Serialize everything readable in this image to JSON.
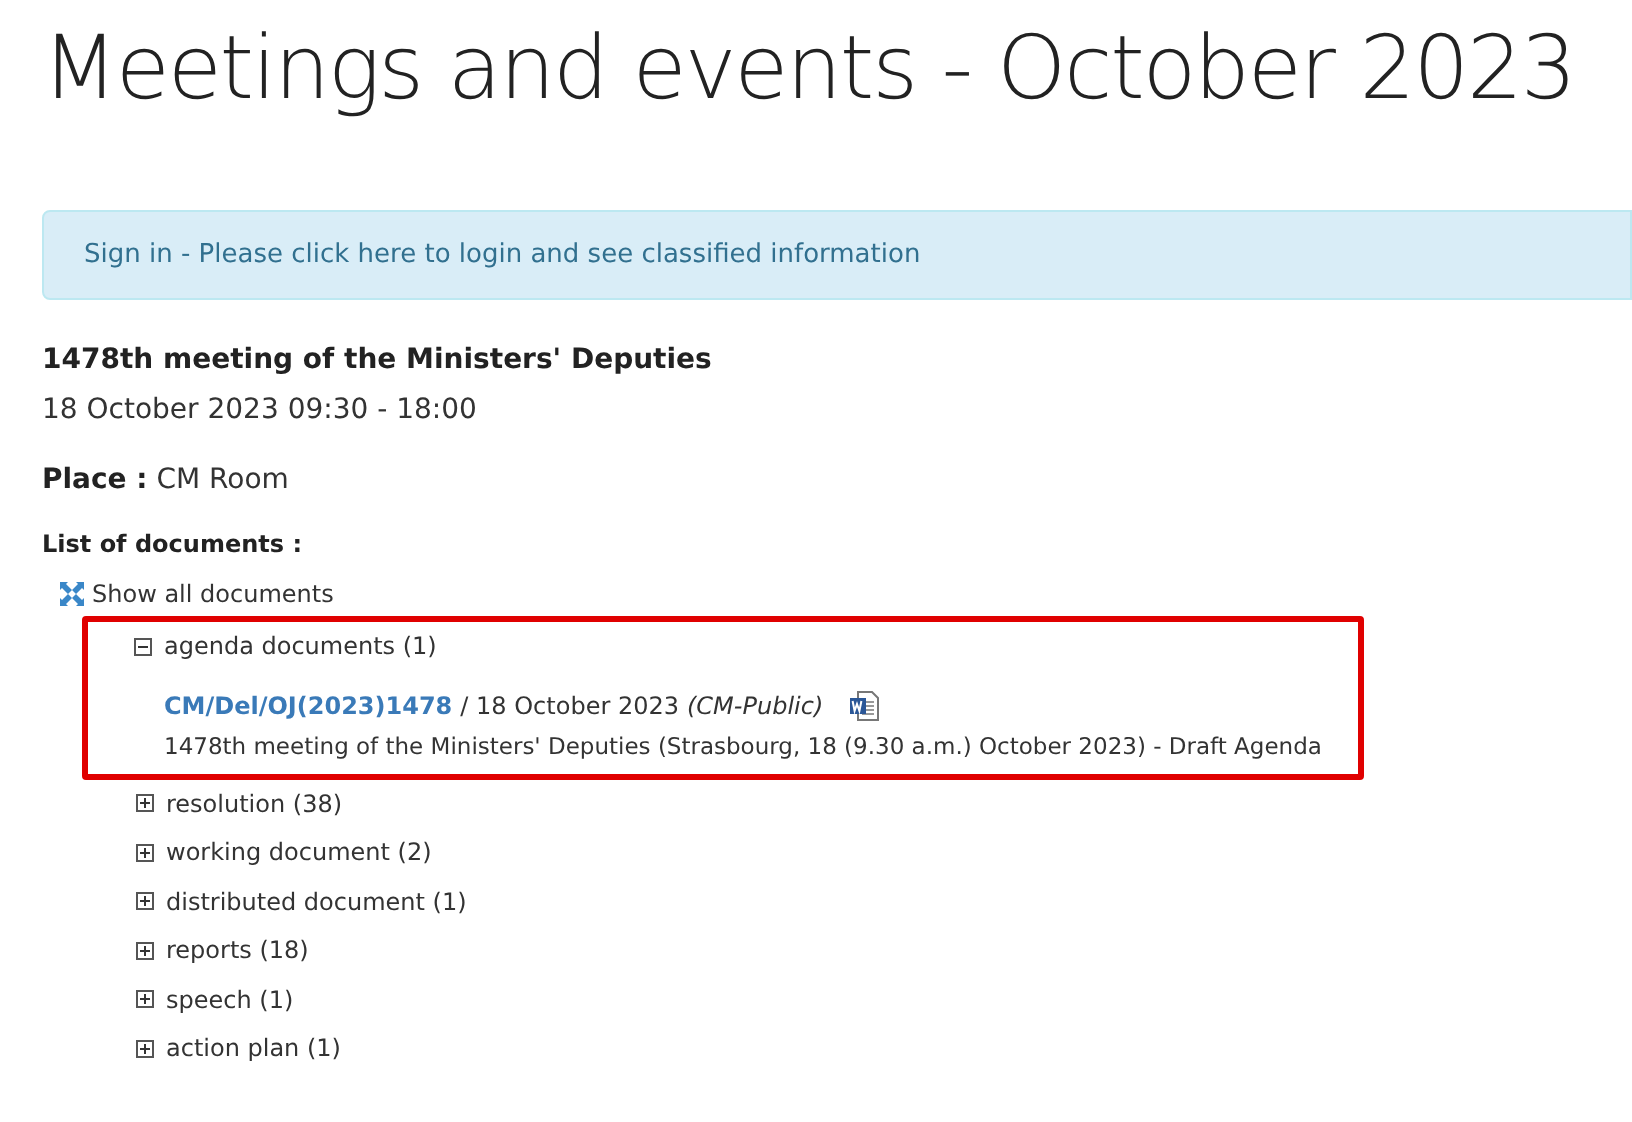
{
  "page_title": "Meetings and events - October 2023",
  "alert": {
    "text": "Sign in - Please click here to login and see classified information"
  },
  "meeting": {
    "title": "1478th meeting of the Ministers' Deputies",
    "date": "18 October 2023 09:30 - 18:00",
    "place_label": "Place :",
    "place": "CM Room"
  },
  "documents_heading": "List of documents :",
  "show_all": "Show all documents",
  "categories": [
    {
      "label": "agenda documents (1)",
      "expanded": true,
      "highlighted": true,
      "documents": [
        {
          "reference": "CM/Del/OJ(2023)1478",
          "date": "/ 18 October 2023",
          "classification": "(CM-Public)",
          "description": "1478th meeting of the Ministers' Deputies (Strasbourg, 18 (9.30 a.m.) October 2023) - Draft Agenda"
        }
      ]
    },
    {
      "label": "resolution (38)",
      "expanded": false
    },
    {
      "label": "working document (2)",
      "expanded": false
    },
    {
      "label": "distributed document (1)",
      "expanded": false
    },
    {
      "label": "reports (18)",
      "expanded": false
    },
    {
      "label": "speech (1)",
      "expanded": false
    },
    {
      "label": "action plan (1)",
      "expanded": false
    }
  ]
}
